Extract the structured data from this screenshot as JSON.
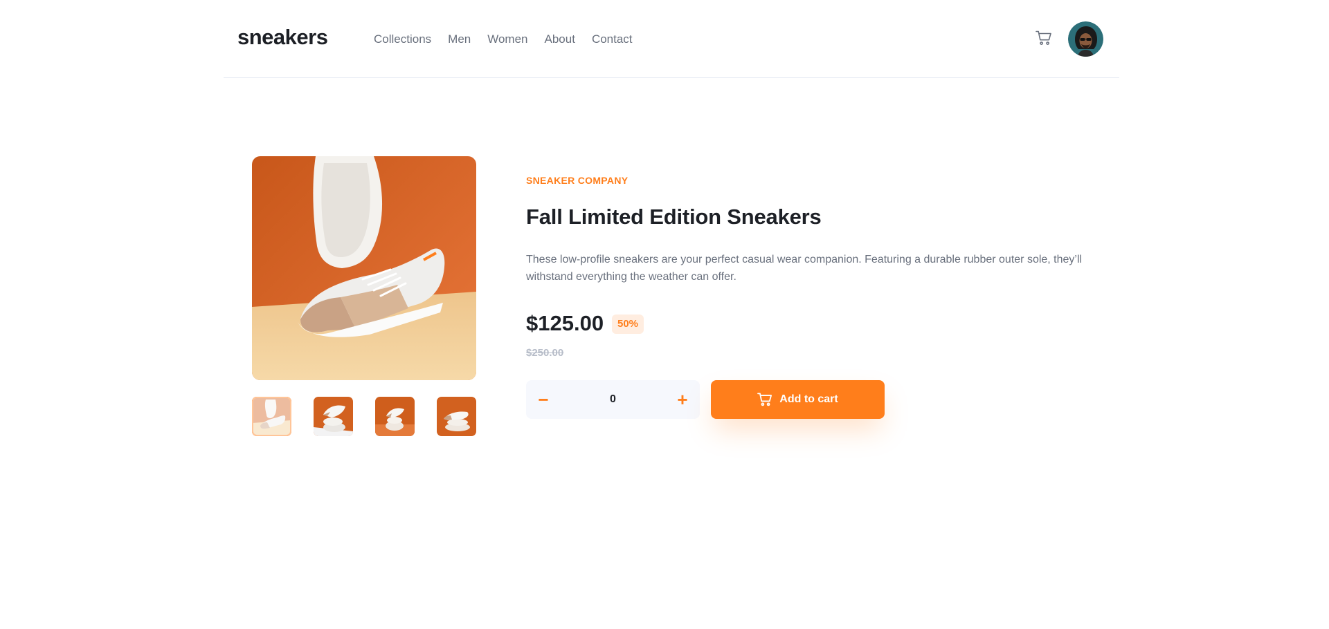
{
  "header": {
    "logo": "sneakers",
    "nav": [
      "Collections",
      "Men",
      "Women",
      "About",
      "Contact"
    ],
    "cart_icon": "cart-icon",
    "avatar_icon": "avatar"
  },
  "gallery": {
    "main_image": "sneaker-product-image",
    "thumbnails": [
      "thumbnail-1",
      "thumbnail-2",
      "thumbnail-3",
      "thumbnail-4"
    ],
    "active_thumbnail": 0
  },
  "product": {
    "company": "SNEAKER COMPANY",
    "title": "Fall Limited Edition Sneakers",
    "description": "These low-profile sneakers are your perfect casual wear companion. Featuring a durable rubber outer sole, they’ll withstand everything the weather can offer.",
    "price": "$125.00",
    "discount": "50%",
    "old_price": "$250.00"
  },
  "quantity": {
    "minus_symbol": "−",
    "value": "0",
    "plus_symbol": "+"
  },
  "cart_button": {
    "label": "Add to cart",
    "icon": "cart-icon"
  },
  "colors": {
    "accent": "#ff7e1b",
    "accent_pale": "#ffede0",
    "text_dark": "#1d2026",
    "text_muted": "#69707d",
    "text_faint": "#b6bcc8",
    "surface": "#f6f8fd"
  }
}
